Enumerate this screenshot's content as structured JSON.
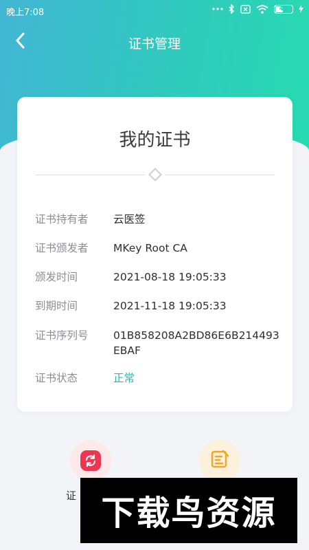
{
  "status_bar": {
    "time": "晚上7:08",
    "battery": "41"
  },
  "nav": {
    "title": "证书管理"
  },
  "card": {
    "title": "我的证书",
    "rows": [
      {
        "label": "证书持有者",
        "value": "云医签"
      },
      {
        "label": "证书颁发者",
        "value": "MKey Root CA"
      },
      {
        "label": "颁发时间",
        "value": "2021-08-18 19:05:33"
      },
      {
        "label": "到期时间",
        "value": "2021-11-18 19:05:33"
      },
      {
        "label": "证书序列号",
        "value": "01B858208A2BD86E6B214493EBAF"
      },
      {
        "label": "证书状态",
        "value": "正常"
      }
    ]
  },
  "actions": {
    "renew_label": "证"
  },
  "watermark": {
    "text": "下载鸟资源"
  },
  "colors": {
    "accent": "#2fcbbc",
    "status_ok": "#23b8b0",
    "renew": "#ec3652",
    "update": "#f2a622"
  },
  "icons": [
    "back-arrow-icon",
    "refresh-icon",
    "edit-doc-icon",
    "bluetooth-icon",
    "wifi-icon",
    "battery-icon"
  ]
}
